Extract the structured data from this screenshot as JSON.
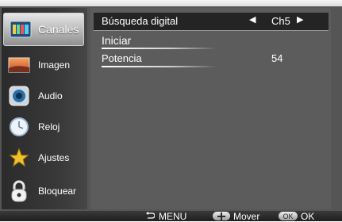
{
  "sidebar": {
    "items": [
      {
        "label": "Canales",
        "icon": "tv-channels-icon",
        "active": true
      },
      {
        "label": "Imagen",
        "icon": "picture-icon",
        "active": false
      },
      {
        "label": "Audio",
        "icon": "speaker-icon",
        "active": false
      },
      {
        "label": "Reloj",
        "icon": "clock-icon",
        "active": false
      },
      {
        "label": "Ajustes",
        "icon": "star-settings-icon",
        "active": false
      },
      {
        "label": "Bloquear",
        "icon": "lock-icon",
        "active": false
      }
    ]
  },
  "main": {
    "rows": [
      {
        "label": "Búsqueda digital",
        "value": "Ch5",
        "selected": true
      },
      {
        "label": "Iniciar",
        "value": "",
        "selected": false
      },
      {
        "label": "Potencia",
        "value": "54",
        "selected": false
      }
    ]
  },
  "bottombar": {
    "menu_label": "MENU",
    "move_label": "Mover",
    "ok_badge": "OK",
    "ok_label": "OK"
  },
  "colors": {
    "background": "#555555",
    "selected_row": "#242424",
    "sidebar_active": "#d0d0d0"
  }
}
